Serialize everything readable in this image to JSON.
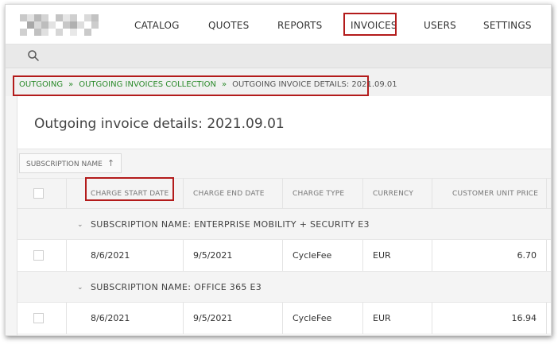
{
  "nav": {
    "items": [
      "CATALOG",
      "QUOTES",
      "REPORTS",
      "INVOICES",
      "USERS",
      "SETTINGS"
    ],
    "active": "INVOICES"
  },
  "search": {
    "icon": "search-icon"
  },
  "breadcrumb": {
    "items": [
      "OUTGOING",
      "OUTGOING INVOICES COLLECTION",
      "OUTGOING INVOICE DETAILS: 2021.09.01"
    ],
    "separator": "»"
  },
  "page": {
    "title": "Outgoing invoice details: 2021.09.01"
  },
  "grouping": {
    "chip_label": "SUBSCRIPTION NAME",
    "sort_icon": "↑"
  },
  "table": {
    "columns": [
      "CHARGE START DATE",
      "CHARGE END DATE",
      "CHARGE TYPE",
      "CURRENCY",
      "CUSTOMER UNIT PRICE"
    ],
    "groups": [
      {
        "label": "SUBSCRIPTION NAME: ENTERPRISE MOBILITY + SECURITY E3",
        "rows": [
          {
            "start": "8/6/2021",
            "end": "9/5/2021",
            "type": "CycleFee",
            "currency": "EUR",
            "price": "6.70"
          }
        ]
      },
      {
        "label": "SUBSCRIPTION NAME: OFFICE 365 E3",
        "rows": [
          {
            "start": "8/6/2021",
            "end": "9/5/2021",
            "type": "CycleFee",
            "currency": "EUR",
            "price": "16.94"
          }
        ]
      }
    ]
  },
  "colors": {
    "highlight": "#b31b1b",
    "breadcrumb_link": "#2a8a2a"
  }
}
